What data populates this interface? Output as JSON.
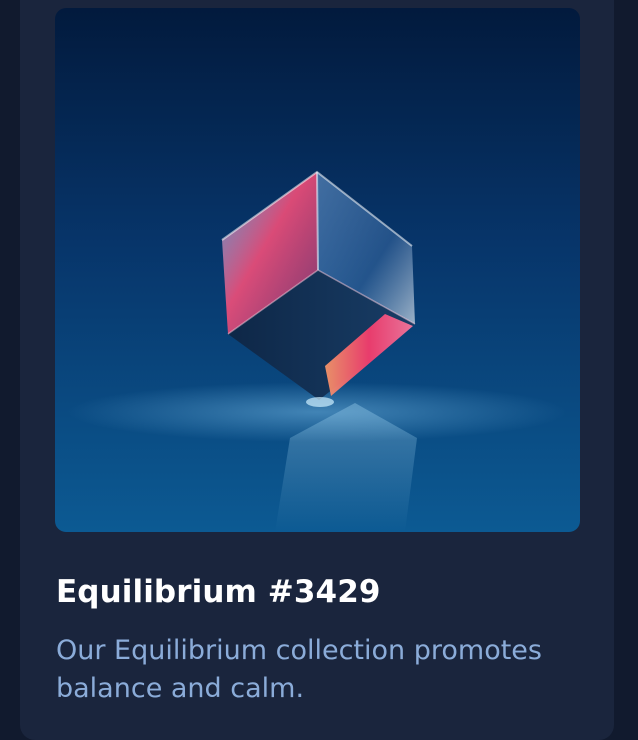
{
  "card": {
    "image": {
      "subject": "glass-cube-image"
    },
    "title": "Equilibrium #3429",
    "description": "Our Equilibrium collection promotes balance and calm."
  },
  "colors": {
    "page_background": "#111a2e",
    "card_background": "#1a253d",
    "title": "#ffffff",
    "description": "#8bacd9"
  }
}
